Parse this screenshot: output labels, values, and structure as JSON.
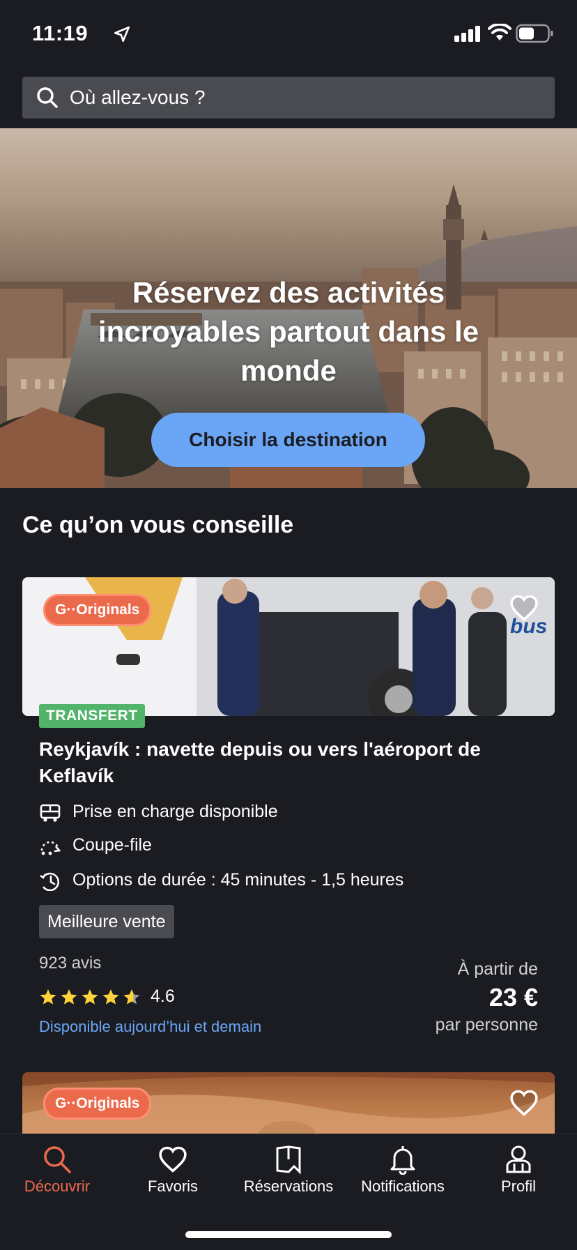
{
  "status_bar": {
    "time": "11:19"
  },
  "search": {
    "placeholder": "Où allez-vous ?"
  },
  "hero": {
    "headline": "Réservez des activités incroyables partout dans le monde",
    "cta_label": "Choisir la destination"
  },
  "section": {
    "title": "Ce qu’on vous conseille"
  },
  "card": {
    "badge": "G··Originals",
    "category": "TRANSFERT",
    "title": "Reykjavík : navette depuis ou vers l'aéroport de Keflavík",
    "features": [
      {
        "icon": "bus-icon",
        "label": "Prise en charge disponible"
      },
      {
        "icon": "skip-line-icon",
        "label": "Coupe-file"
      },
      {
        "icon": "duration-icon",
        "label": "Options de durée : 45 minutes - 1,5 heures"
      }
    ],
    "highlight": "Meilleure vente",
    "reviews": "923 avis",
    "rating": 4.6,
    "rating_label": "4.6",
    "availability": "Disponible aujourd’hui et demain",
    "price_from": "À partir de",
    "price": "23 €",
    "price_per": "par personne"
  },
  "card2": {
    "badge": "G··Originals"
  },
  "tabbar": {
    "tabs": [
      {
        "icon": "search-icon",
        "label": "Découvrir",
        "active": true
      },
      {
        "icon": "heart-icon",
        "label": "Favoris"
      },
      {
        "icon": "bookmark-icon",
        "label": "Réservations"
      },
      {
        "icon": "bell-icon",
        "label": "Notifications"
      },
      {
        "icon": "profile-icon",
        "label": "Profil"
      }
    ]
  },
  "colors": {
    "accent": "#6aa6f5",
    "active_tab": "#ec6a4c",
    "tag": "#52b36a",
    "badge": "#ec6a4c",
    "star": "#ffd43b"
  }
}
